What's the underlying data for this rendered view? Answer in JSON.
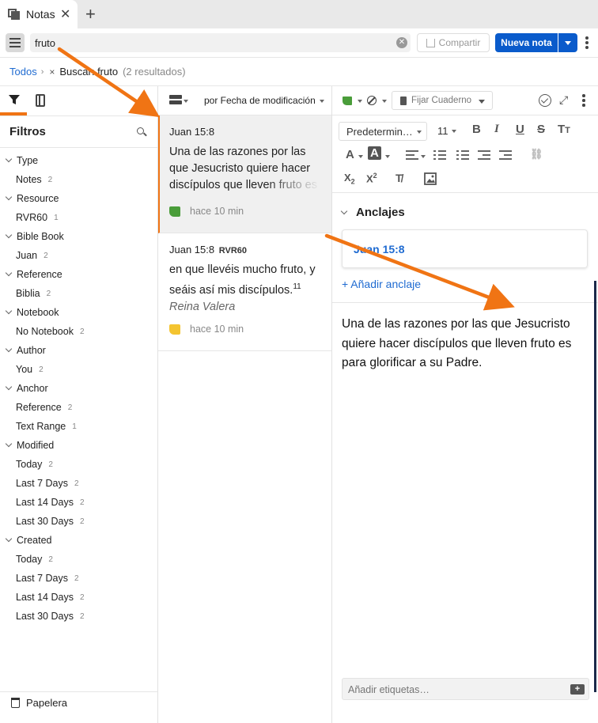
{
  "tab": {
    "title": "Notas",
    "close": "✕",
    "add": "+"
  },
  "toolbar": {
    "search_value": "fruto",
    "share_label": "Compartir",
    "new_note_label": "Nueva nota"
  },
  "breadcrumb": {
    "all": "Todos",
    "sep": "›",
    "remove": "×",
    "search": "Buscar: fruto",
    "count": "(2 resultados)"
  },
  "sidebar": {
    "filters_title": "Filtros",
    "groups": [
      {
        "label": "Type",
        "items": [
          {
            "label": "Notes",
            "count": "2"
          }
        ]
      },
      {
        "label": "Resource",
        "items": [
          {
            "label": "RVR60",
            "count": "1"
          }
        ]
      },
      {
        "label": "Bible Book",
        "items": [
          {
            "label": "Juan",
            "count": "2"
          }
        ]
      },
      {
        "label": "Reference",
        "items": [
          {
            "label": "Biblia",
            "count": "2"
          }
        ]
      },
      {
        "label": "Notebook",
        "items": [
          {
            "label": "No Notebook",
            "count": "2"
          }
        ]
      },
      {
        "label": "Author",
        "items": [
          {
            "label": "You",
            "count": "2"
          }
        ]
      },
      {
        "label": "Anchor",
        "items": [
          {
            "label": "Reference",
            "count": "2"
          },
          {
            "label": "Text Range",
            "count": "1"
          }
        ]
      },
      {
        "label": "Modified",
        "items": [
          {
            "label": "Today",
            "count": "2"
          },
          {
            "label": "Last 7 Days",
            "count": "2"
          },
          {
            "label": "Last 14 Days",
            "count": "2"
          },
          {
            "label": "Last 30 Days",
            "count": "2"
          }
        ]
      },
      {
        "label": "Created",
        "items": [
          {
            "label": "Today",
            "count": "2"
          },
          {
            "label": "Last 7 Days",
            "count": "2"
          },
          {
            "label": "Last 14 Days",
            "count": "2"
          },
          {
            "label": "Last 30 Days",
            "count": "2"
          }
        ]
      }
    ],
    "trash_label": "Papelera"
  },
  "notes_list": {
    "sort_label": "por Fecha de modificación",
    "notes": [
      {
        "title": "Juan 15:8",
        "resource": "",
        "snippet": "Una de las razones por las que Jesucristo quiere hacer discípulos que lleven fruto es para glorificar a su Padre.",
        "time": "hace 10 min",
        "color": "#4a9d3a"
      },
      {
        "title": "Juan 15:8",
        "resource": "RVR60",
        "snippet": "en que llevéis mucho fruto, y seáis así mis discípulos.",
        "verse": "11",
        "source": "Reina Valera",
        "time": "hace 10 min",
        "color": "#f4c430"
      }
    ]
  },
  "editor": {
    "pin_notebook": "Fijar Cuaderno",
    "font": "Predetermin…",
    "font_size": "11",
    "anchors_title": "Anclajes",
    "anchor_ref": "Juan 15:8",
    "add_anchor": "+ Añadir anclaje",
    "body": "Una de las razones por las que Jesucristo quiere hacer discípulos que lleven fruto es para glorificar a su Padre.",
    "tags_placeholder": "Añadir etiquetas…"
  },
  "colors": {
    "accent": "#f07414",
    "brand_blue": "#0a5bcb",
    "link_blue": "#1f6bd1"
  }
}
